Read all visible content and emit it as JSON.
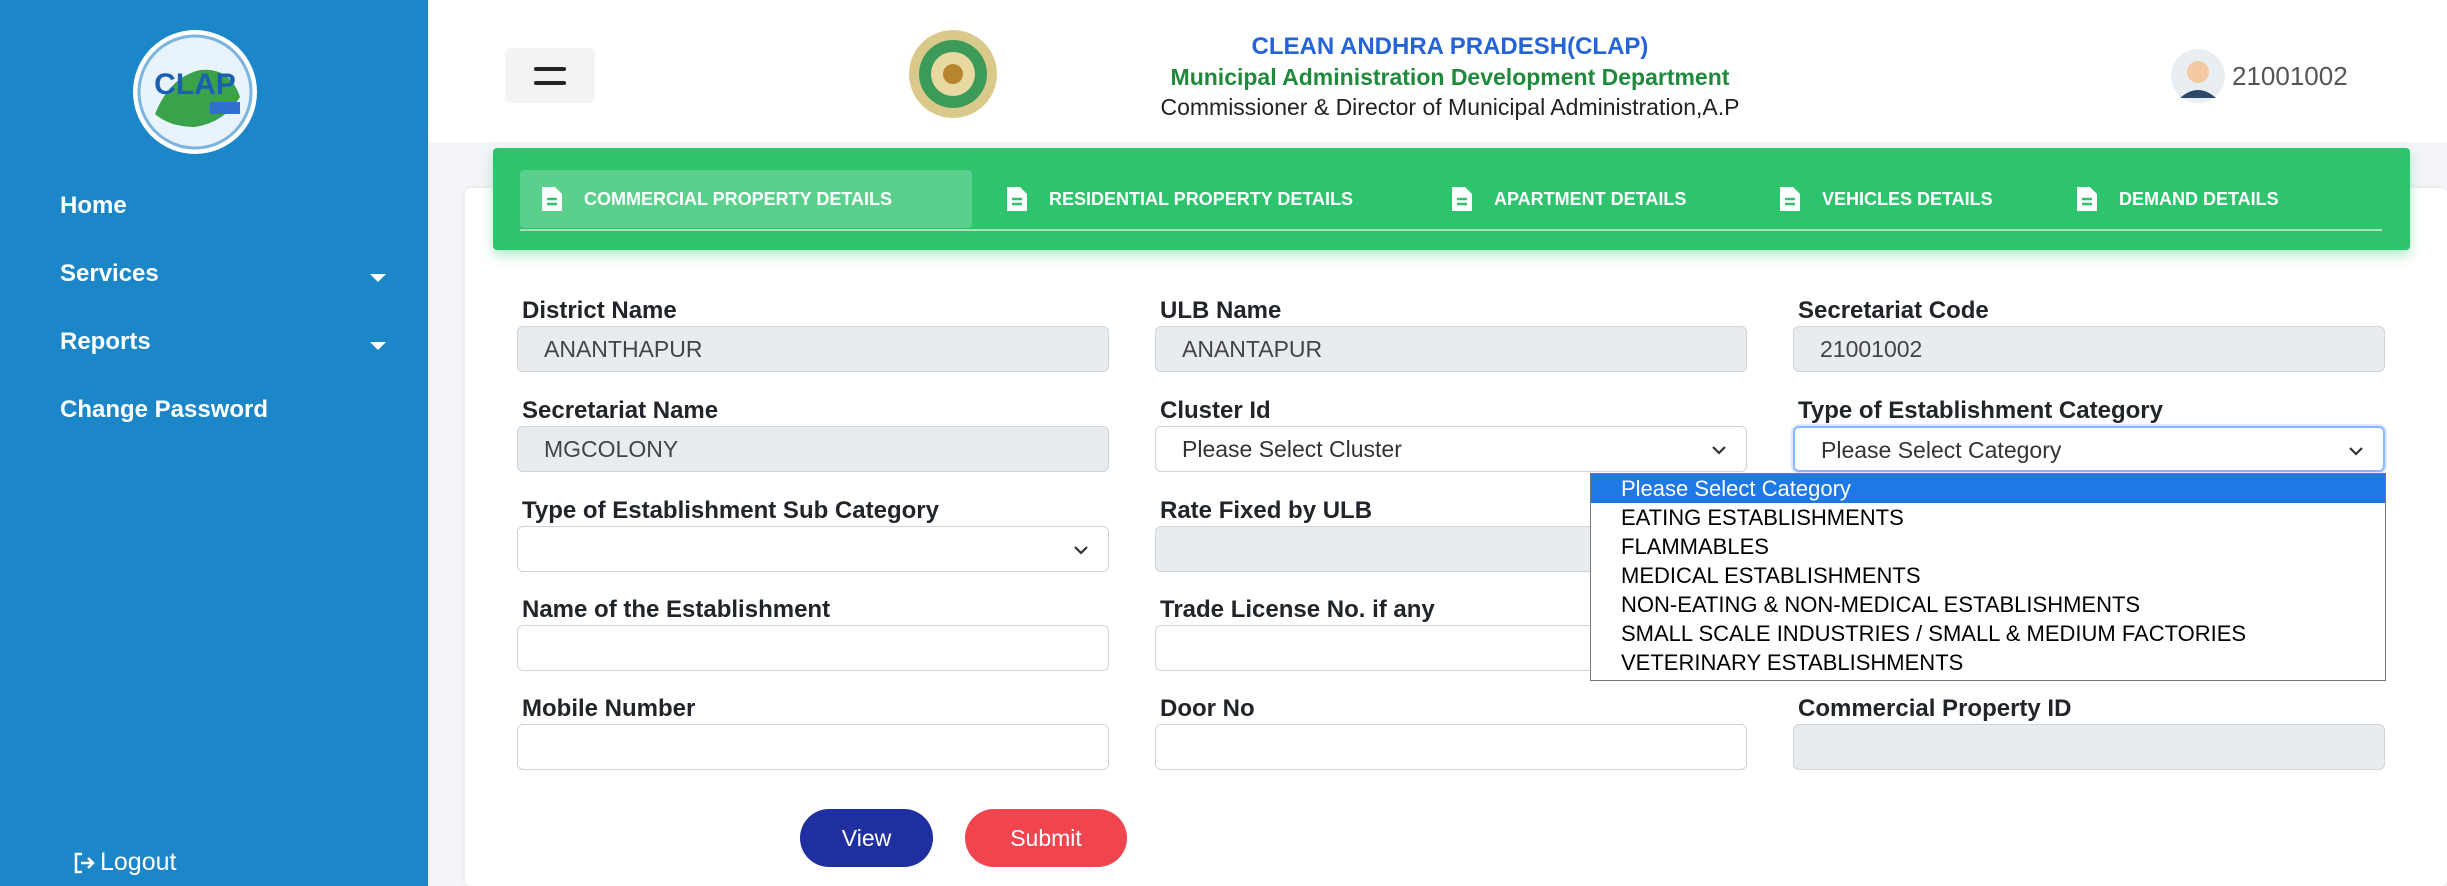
{
  "sidebar": {
    "items": [
      {
        "label": "Home"
      },
      {
        "label": "Services"
      },
      {
        "label": "Reports"
      },
      {
        "label": "Change Password"
      }
    ],
    "logout_label": "Logout",
    "logo_icon": "clap-logo-icon"
  },
  "header": {
    "title": "CLEAN ANDHRA PRADESH(CLAP)",
    "subtitle": "Municipal Administration Development Department",
    "org": "Commissioner & Director of Municipal Administration,A.P",
    "user_id": "21001002",
    "menu_icon": "hamburger-icon"
  },
  "tabs": [
    {
      "label": "COMMERCIAL PROPERTY DETAILS"
    },
    {
      "label": "RESIDENTIAL PROPERTY DETAILS"
    },
    {
      "label": "APARTMENT DETAILS"
    },
    {
      "label": "VEHICLES DETAILS"
    },
    {
      "label": "DEMAND DETAILS"
    }
  ],
  "form": {
    "district_name": {
      "label": "District Name",
      "value": "ANANTHAPUR"
    },
    "ulb_name": {
      "label": "ULB Name",
      "value": "ANANTAPUR"
    },
    "secretariat_code": {
      "label": "Secretariat Code",
      "value": "21001002"
    },
    "secretariat_name": {
      "label": "Secretariat Name",
      "value": "MGCOLONY"
    },
    "cluster_id": {
      "label": "Cluster Id",
      "value": "Please Select Cluster"
    },
    "category": {
      "label": "Type of Establishment Category",
      "value": "Please Select Category"
    },
    "sub_category": {
      "label": "Type of Establishment Sub Category",
      "value": ""
    },
    "rate_fixed": {
      "label": "Rate Fixed by ULB",
      "value": ""
    },
    "establishment_name": {
      "label": "Name of the Establishment",
      "value": ""
    },
    "trade_license": {
      "label": "Trade License No. if any",
      "value": ""
    },
    "mobile_number": {
      "label": "Mobile Number",
      "value": ""
    },
    "door_no": {
      "label": "Door No",
      "value": ""
    },
    "commercial_property_id": {
      "label": "Commercial Property ID",
      "value": ""
    }
  },
  "category_options": [
    "Please Select Category",
    "EATING ESTABLISHMENTS",
    "FLAMMABLES",
    "MEDICAL ESTABLISHMENTS",
    "NON-EATING & NON-MEDICAL ESTABLISHMENTS",
    "SMALL SCALE INDUSTRIES / SMALL & MEDIUM FACTORIES",
    "VETERINARY ESTABLISHMENTS"
  ],
  "buttons": {
    "view": "View",
    "submit": "Submit"
  },
  "colors": {
    "sidebar": "#1b86c8",
    "tab_bar": "#2ec36d",
    "view_button": "#1f2fa0",
    "submit_button": "#f0444f",
    "selected_option": "#1e78e6"
  }
}
